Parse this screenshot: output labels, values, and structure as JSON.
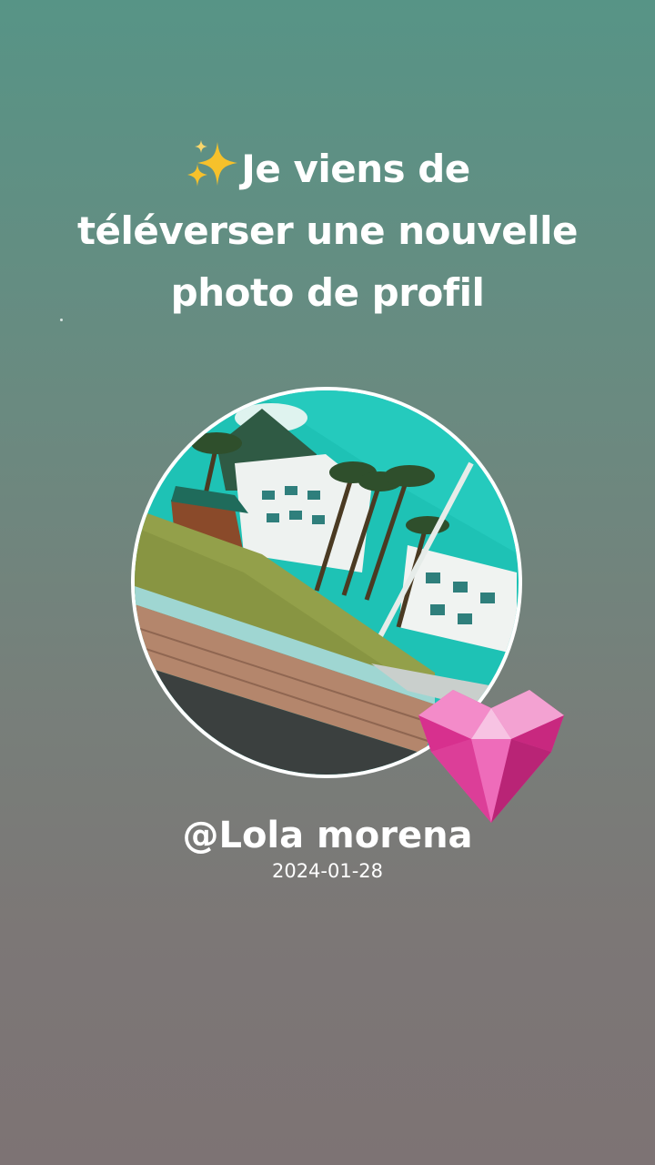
{
  "post": {
    "headline_line1": "Je viens de",
    "headline_line2": "téléverser une nouvelle",
    "headline_line3": "photo de profil",
    "sparkle_icon": "sparkles-icon",
    "username": "@Lola morena",
    "date": "2024-01-28",
    "profile_photo": "seaside-promenade-photo",
    "sticker_icon": "pink-gem-heart-icon"
  },
  "colors": {
    "background_top": "#579486",
    "background_bottom": "#7d7374",
    "text": "#ffffff",
    "heart_pink": "#e84aa8",
    "sky_teal": "#19c4b6"
  }
}
